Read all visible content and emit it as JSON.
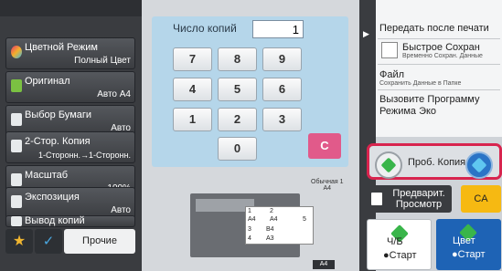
{
  "left_panel": {
    "items": [
      {
        "label": "Цветной Режим",
        "value": "Полный Цвет",
        "icon": "color-mode-icon",
        "color": "#d83b7c"
      },
      {
        "label": "Оригинал",
        "value": "Авто  A4",
        "icon": "original-icon",
        "color": "#7bc142"
      },
      {
        "label": "Выбор Бумаги",
        "value": "Авто",
        "icon": "paper-select-icon",
        "color": "#e7eaec"
      },
      {
        "label": "2-Стор. Копия",
        "value": "1-Сторонн.→1-Сторонн.",
        "icon": "duplex-icon",
        "color": "#e7eaec"
      },
      {
        "label": "Масштаб",
        "value": "100%",
        "icon": "scale-icon",
        "color": "#e7eaec"
      },
      {
        "label": "Экспозиция",
        "value": "Авто",
        "icon": "exposure-icon",
        "color": "#e7eaec"
      },
      {
        "label": "Вывод копий",
        "value": "",
        "icon": "output-icon",
        "color": "#e7eaec"
      }
    ],
    "bottom": {
      "star_icon": "star-icon",
      "check_icon": "check-icon",
      "other_label": "Прочие"
    }
  },
  "keypad": {
    "title": "Число копий",
    "display_value": "1",
    "keys": [
      "7",
      "8",
      "9",
      "4",
      "5",
      "6",
      "1",
      "2",
      "3",
      "0"
    ],
    "clear_label": "C"
  },
  "preview": {
    "output_label_1": "Обычная 1",
    "output_label_2": "A4",
    "tray_rows": [
      {
        "n": "1",
        "size": "A4"
      },
      {
        "n": "2",
        "size": "A4"
      },
      {
        "n": "3",
        "size": "B4"
      },
      {
        "n": "4",
        "size": "A3"
      }
    ],
    "tray5": "5",
    "a4_tag": "A4"
  },
  "right_panel": {
    "send_after_print": "Передать после печати",
    "quick_save": "Быстрое Сохран",
    "quick_save_sub": "Временно Сохран. Данные",
    "file": "Файл",
    "file_sub": "Сохранить Данные в Папке",
    "eco": "Вызовите Программу Режима Эко"
  },
  "actions": {
    "trial_copy": "Проб. Копия",
    "preview_l1": "Предварит.",
    "preview_l2": "Просмотр",
    "ca": "CA",
    "bw_l1": "Ч/Б",
    "bw_l2": "●Старт",
    "color_l1": "Цвет",
    "color_l2": "●Старт"
  }
}
